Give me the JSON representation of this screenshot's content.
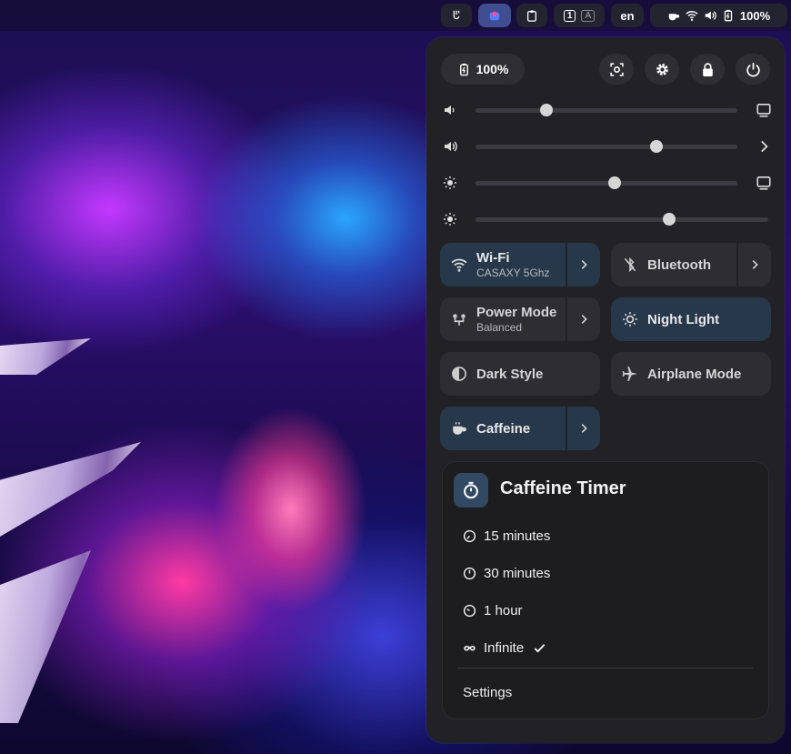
{
  "topbar": {
    "indicators": [
      "caffeine-sidebar-icon",
      "app-icon",
      "clipboard-icon"
    ],
    "workspace_1": "1",
    "workspace_2": "A",
    "language": "en",
    "battery": "100%"
  },
  "quick_settings": {
    "battery_chip": "100%",
    "header_buttons": [
      "screenshot-icon",
      "gear-icon",
      "lock-icon",
      "power-icon"
    ],
    "sliders": [
      {
        "name": "volume-output-1",
        "level": 0.27,
        "end_icon": "monitor-icon"
      },
      {
        "name": "volume-output-2",
        "level": 0.69,
        "end_icon": "chevron-right-icon"
      },
      {
        "name": "brightness-display",
        "level": 0.53,
        "end_icon": "monitor-icon"
      },
      {
        "name": "brightness-keyboard",
        "level": 0.66,
        "end_icon": ""
      }
    ],
    "tiles": {
      "wifi": {
        "title": "Wi-Fi",
        "subtitle": "CASAXY 5Ghz",
        "active": true
      },
      "bluetooth": {
        "title": "Bluetooth",
        "active": false
      },
      "power_mode": {
        "title": "Power Mode",
        "subtitle": "Balanced",
        "active": false
      },
      "night_light": {
        "title": "Night Light",
        "active": true
      },
      "dark_style": {
        "title": "Dark Style",
        "active": false
      },
      "airplane_mode": {
        "title": "Airplane Mode",
        "active": false
      },
      "caffeine": {
        "title": "Caffeine",
        "active": true
      }
    },
    "caffeine_menu": {
      "title": "Caffeine Timer",
      "items": [
        "15 minutes",
        "30 minutes",
        "1 hour",
        "Infinite"
      ],
      "selected": "Infinite",
      "settings": "Settings"
    }
  },
  "colors": {
    "panel_bg": "#222226",
    "tile_bg": "#2d2d32",
    "tile_active_bg": "#27384b",
    "menu_bg": "#1d1d20"
  }
}
